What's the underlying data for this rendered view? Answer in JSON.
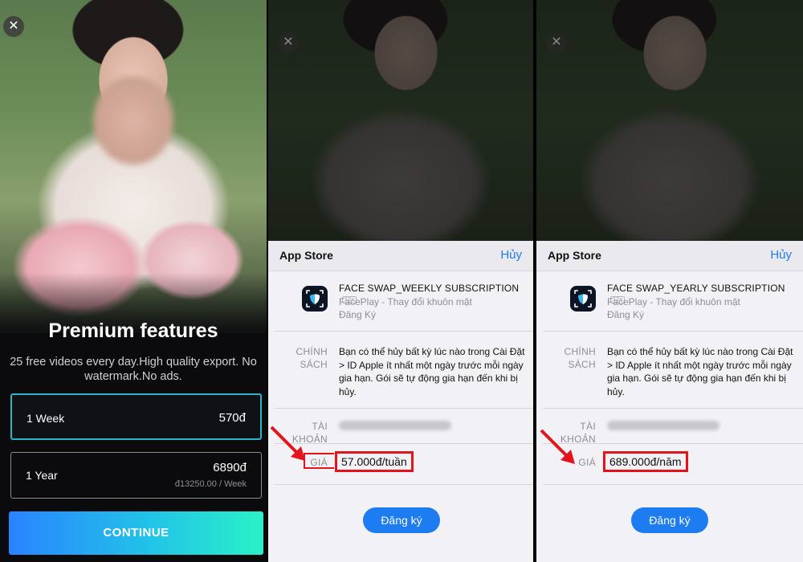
{
  "paywall": {
    "title": "Premium features",
    "subtitle": "25 free videos every day.High quality export. No watermark.No ads.",
    "plans": [
      {
        "name": "1 Week",
        "price": "570đ",
        "per": ""
      },
      {
        "name": "1 Year",
        "price": "6890đ",
        "per": "đ13250.00 / Week"
      }
    ],
    "continue_label": "CONTINUE",
    "close_icon": "✕"
  },
  "sheets": [
    {
      "header_title": "App Store",
      "cancel_label": "Hủy",
      "product_name": "FACE SWAP_WEEKLY SUBSCRIPTION",
      "age_badge": "12+",
      "app_name": "FacePlay - Thay đổi khuôn mặt",
      "subscription_type": "Đăng Ký",
      "policy_label": "CHÍNH SÁCH",
      "policy_text": "Bạn có thể hủy bất kỳ lúc nào trong Cài Đặt > ID Apple ít nhất một ngày trước mỗi ngày gia hạn. Gói sẽ tự động gia hạn đến khi bị hủy.",
      "account_label": "TÀI KHOẢN",
      "price_label": "GIÁ",
      "price": "57.000đ/tuần",
      "subscribe_label": "Đăng ký"
    },
    {
      "header_title": "App Store",
      "cancel_label": "Hủy",
      "product_name": "FACE SWAP_YEARLY SUBSCRIPTION",
      "age_badge": "12+",
      "app_name": "FacePlay - Thay đổi khuôn mặt",
      "subscription_type": "Đăng Ký",
      "policy_label": "CHÍNH SÁCH",
      "policy_text": "Bạn có thể hủy bất kỳ lúc nào trong Cài Đặt > ID Apple ít nhất một ngày trước mỗi ngày gia hạn. Gói sẽ tự động gia hạn đến khi bị hủy.",
      "account_label": "TÀI KHOẢN",
      "price_label": "GIÁ",
      "price": "689.000đ/năm",
      "subscribe_label": "Đăng ký"
    }
  ],
  "colors": {
    "accent_blue": "#1d7cf2",
    "highlight_red": "#e3141c",
    "plan_selected_border": "#2bb6c7"
  }
}
